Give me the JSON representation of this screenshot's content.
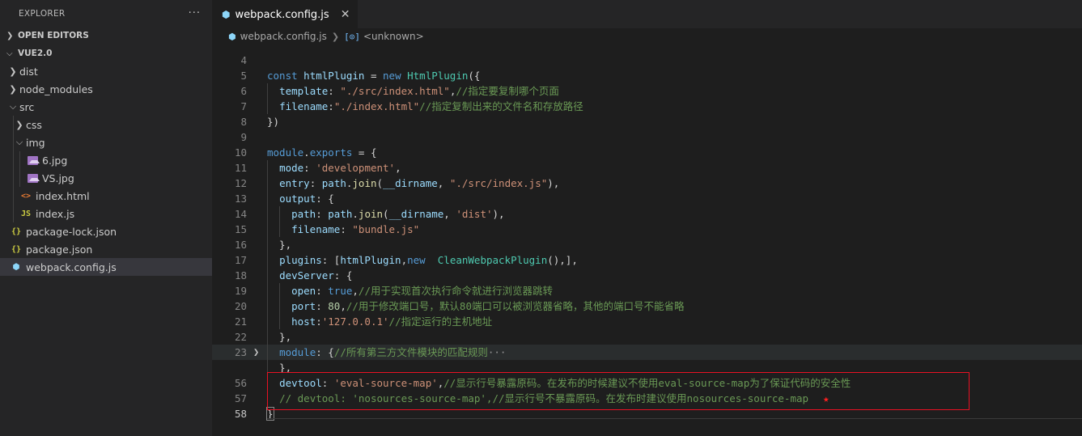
{
  "sidebar": {
    "title": "EXPLORER",
    "more": "···",
    "sections": {
      "open_editors": "OPEN EDITORS",
      "project": "VUE2.0"
    },
    "tree": [
      {
        "label": "dist",
        "kind": "folder",
        "expanded": false,
        "depth": 1
      },
      {
        "label": "node_modules",
        "kind": "folder",
        "expanded": false,
        "depth": 1
      },
      {
        "label": "src",
        "kind": "folder",
        "expanded": true,
        "depth": 1
      },
      {
        "label": "css",
        "kind": "folder",
        "expanded": false,
        "depth": 2
      },
      {
        "label": "img",
        "kind": "folder",
        "expanded": true,
        "depth": 2
      },
      {
        "label": "6.jpg",
        "kind": "image",
        "depth": 3
      },
      {
        "label": "VS.jpg",
        "kind": "image",
        "depth": 3
      },
      {
        "label": "index.html",
        "kind": "html",
        "depth": 2
      },
      {
        "label": "index.js",
        "kind": "js",
        "depth": 2
      },
      {
        "label": "package-lock.json",
        "kind": "json",
        "depth": 1
      },
      {
        "label": "package.json",
        "kind": "json",
        "depth": 1
      },
      {
        "label": "webpack.config.js",
        "kind": "webpack",
        "depth": 1,
        "selected": true
      }
    ]
  },
  "editor": {
    "tab": {
      "label": "webpack.config.js",
      "close": "✕"
    },
    "breadcrumb": {
      "file": "webpack.config.js",
      "symbol": "<unknown>"
    },
    "lines": [
      {
        "n": "4",
        "code": ""
      },
      {
        "n": "5",
        "code": "const htmlPlugin = new HtmlPlugin({"
      },
      {
        "n": "6",
        "code": "  template: \"./src/index.html\",//指定要复制哪个页面"
      },
      {
        "n": "7",
        "code": "  filename:\"./index.html\"//指定复制出来的文件名和存放路径"
      },
      {
        "n": "8",
        "code": "})"
      },
      {
        "n": "9",
        "code": ""
      },
      {
        "n": "10",
        "code": "module.exports = {"
      },
      {
        "n": "11",
        "code": "  mode: 'development',"
      },
      {
        "n": "12",
        "code": "  entry: path.join(__dirname, \"./src/index.js\"),"
      },
      {
        "n": "13",
        "code": "  output: {"
      },
      {
        "n": "14",
        "code": "    path: path.join(__dirname, 'dist'),"
      },
      {
        "n": "15",
        "code": "    filename: \"bundle.js\""
      },
      {
        "n": "16",
        "code": "  },"
      },
      {
        "n": "17",
        "code": "  plugins: [htmlPlugin,new  CleanWebpackPlugin(),],"
      },
      {
        "n": "18",
        "code": "  devServer: {"
      },
      {
        "n": "19",
        "code": "    open: true,//用于实现首次执行命令就进行浏览器跳转"
      },
      {
        "n": "20",
        "code": "    port: 80,//用于修改端口号，默认80端口可以被浏览器省略，其他的端口号不能省略"
      },
      {
        "n": "21",
        "code": "    host:'127.0.0.1'//指定运行的主机地址"
      },
      {
        "n": "22",
        "code": "  },"
      },
      {
        "n": "23",
        "code": "  module: {//所有第三方文件模块的匹配规则",
        "ellipsis": "···"
      },
      {
        "n": "",
        "code": "  },"
      },
      {
        "n": "56",
        "code": "  devtool: 'eval-source-map',//显示行号暴露原码。在发布的时候建议不使用eval-source-map为了保证代码的安全性"
      },
      {
        "n": "57",
        "code": "  // devtool: 'nosources-source-map',//显示行号不暴露原码。在发布时建议使用nosources-source-map",
        "star": "★"
      },
      {
        "n": "58",
        "code": "}"
      }
    ]
  },
  "colors": {
    "sidebar_bg": "#252526",
    "editor_bg": "#1e1e1e",
    "comment": "#6a9955",
    "keyword": "#569cd6",
    "string": "#ce9178",
    "annotation_box": "#e81123"
  }
}
